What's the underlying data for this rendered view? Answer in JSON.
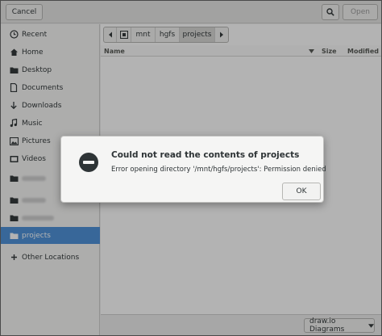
{
  "header": {
    "cancel_label": "Cancel",
    "open_label": "Open"
  },
  "sidebar": {
    "items": [
      {
        "label": "Recent",
        "icon": "clock-icon"
      },
      {
        "label": "Home",
        "icon": "home-icon"
      },
      {
        "label": "Desktop",
        "icon": "folder-icon"
      },
      {
        "label": "Documents",
        "icon": "document-icon"
      },
      {
        "label": "Downloads",
        "icon": "download-arrow-icon"
      },
      {
        "label": "Music",
        "icon": "music-note-icon"
      },
      {
        "label": "Pictures",
        "icon": "picture-icon"
      },
      {
        "label": "Videos",
        "icon": "film-icon"
      },
      {
        "label": "",
        "icon": "folder-icon"
      },
      {
        "label": "",
        "icon": "folder-icon"
      },
      {
        "label": "",
        "icon": "folder-icon"
      },
      {
        "label": "projects",
        "icon": "folder-icon"
      },
      {
        "label": "Other Locations",
        "icon": "plus-icon"
      }
    ]
  },
  "pathbar": {
    "segments": [
      "mnt",
      "hgfs",
      "projects"
    ]
  },
  "columns": {
    "name": "Name",
    "size": "Size",
    "modified": "Modified"
  },
  "filter": {
    "selected": "draw.io Diagrams"
  },
  "dialog": {
    "title": "Could not read the contents of projects",
    "message": "Error opening directory '/mnt/hgfs/projects': Permission denied",
    "ok_label": "OK"
  }
}
